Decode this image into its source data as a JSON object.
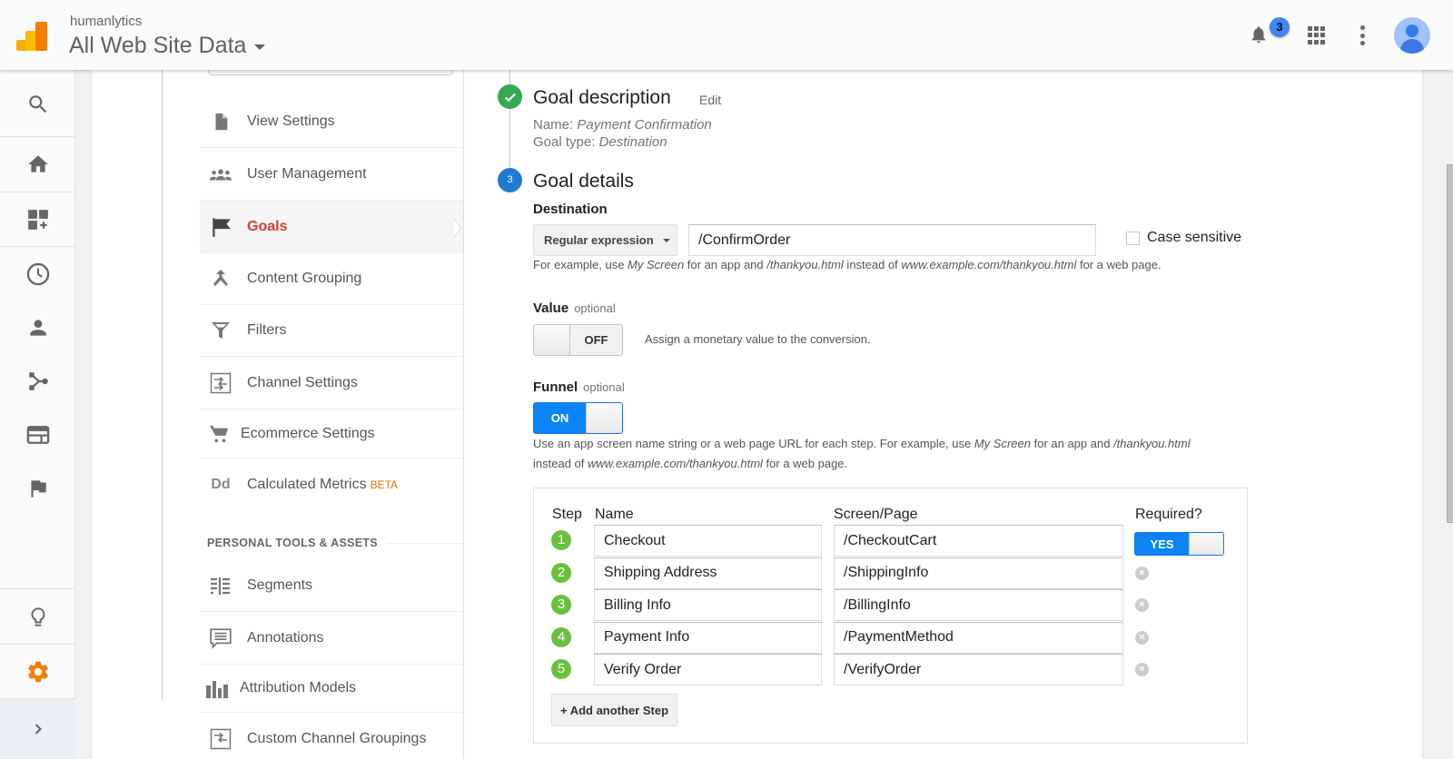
{
  "header": {
    "account": "humanlytics",
    "property": "All Web Site Data",
    "notification_count": "3"
  },
  "rail": {
    "items": [
      "search",
      "home",
      "customization",
      "realtime",
      "audience",
      "acquisition",
      "behavior",
      "conversions",
      "discover",
      "admin",
      "expand"
    ]
  },
  "admin_nav": {
    "items": [
      {
        "label": "View Settings",
        "icon": "document-icon"
      },
      {
        "label": "User Management",
        "icon": "users-icon"
      },
      {
        "label": "Goals",
        "icon": "flag-icon",
        "active": true
      },
      {
        "label": "Content Grouping",
        "icon": "merge-icon"
      },
      {
        "label": "Filters",
        "icon": "filter-icon"
      },
      {
        "label": "Channel Settings",
        "icon": "channel-icon"
      },
      {
        "label": "Ecommerce Settings",
        "icon": "cart-icon"
      },
      {
        "label": "Calculated Metrics",
        "icon": "dd-icon",
        "badge": "BETA"
      }
    ],
    "section_header": "PERSONAL TOOLS & ASSETS",
    "personal_items": [
      {
        "label": "Segments",
        "icon": "segments-icon"
      },
      {
        "label": "Annotations",
        "icon": "annotation-icon"
      },
      {
        "label": "Attribution Models",
        "icon": "attribution-icon"
      },
      {
        "label": "Custom Channel Groupings",
        "icon": "channel-icon"
      }
    ],
    "dd_glyph": "Dd"
  },
  "goal": {
    "description_title": "Goal description",
    "edit_label": "Edit",
    "name_label": "Name:",
    "name_value": "Payment Confirmation",
    "type_label": "Goal type:",
    "type_value": "Destination",
    "details_step": "3",
    "details_title": "Goal details",
    "destination_label": "Destination",
    "match_type": "Regular expression",
    "destination_value": "/ConfirmOrder",
    "case_sensitive_label": "Case sensitive",
    "case_sensitive_checked": false,
    "destination_hint": {
      "p1": "For example, use ",
      "i1": "My Screen",
      "p2": " for an app and ",
      "i2": "/thankyou.html",
      "p3": " instead of ",
      "i3": "www.example.com/thankyou.html",
      "p4": " for a web page."
    },
    "value_label": "Value",
    "optional_label": "optional",
    "value_toggle": "OFF",
    "value_hint": "Assign a monetary value to the conversion.",
    "funnel_label": "Funnel",
    "funnel_toggle": "ON",
    "funnel_hint": {
      "p1": "Use an app screen name string or a web page URL for each step. For example, use ",
      "i1": "My Screen",
      "p2": " for an app and ",
      "i2": "/thankyou.html",
      "p3": "instead of ",
      "i3": "www.example.com/thankyou.html",
      "p4": " for a web page."
    }
  },
  "funnel": {
    "headers": {
      "step": "Step",
      "name": "Name",
      "screen": "Screen/Page",
      "required": "Required?"
    },
    "required_toggle": "YES",
    "steps": [
      {
        "num": "1",
        "name": "Checkout",
        "screen": "/CheckoutCart"
      },
      {
        "num": "2",
        "name": "Shipping Address",
        "screen": "/ShippingInfo"
      },
      {
        "num": "3",
        "name": "Billing Info",
        "screen": "/BillingInfo"
      },
      {
        "num": "4",
        "name": "Payment Info",
        "screen": "/PaymentMethod"
      },
      {
        "num": "5",
        "name": "Verify Order",
        "screen": "/VerifyOrder"
      }
    ],
    "add_step_label": "+ Add another Step",
    "remove_glyph": "×"
  },
  "colors": {
    "accent_orange": "#f57c00",
    "active_red": "#d23f31",
    "toggle_blue": "#0b84f5",
    "check_green": "#34a853",
    "step_green": "#6abf3c",
    "step_blue": "#1e7bd1"
  }
}
